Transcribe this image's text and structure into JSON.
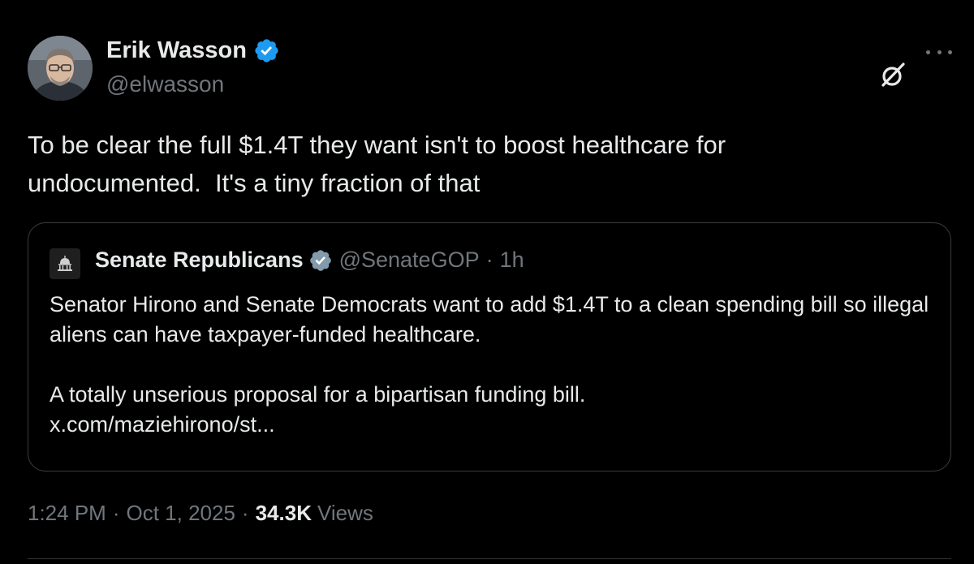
{
  "author": {
    "name": "Erik Wasson",
    "handle": "@elwasson",
    "verified": true
  },
  "tweet": {
    "text": "To be clear the full $1.4T they want isn't to boost healthcare for\nundocumented.  It's a tiny fraction of that"
  },
  "quoted": {
    "name": "Senate Republicans",
    "handle": "@SenateGOP",
    "separator": "·",
    "time": "1h",
    "paragraph1": "Senator Hirono and Senate Democrats want to add $1.4T to a clean spending bill so illegal aliens can have taxpayer-funded healthcare.",
    "paragraph2": "A totally unserious proposal for a bipartisan funding bill.",
    "link": "x.com/maziehirono/st..."
  },
  "meta": {
    "time": "1:24 PM",
    "separator": "·",
    "date": "Oct 1, 2025",
    "views_count": "34.3K",
    "views_label": "Views"
  },
  "icons": {
    "verified": "verified-badge-icon",
    "grok": "grok-icon",
    "more": "more-options-icon",
    "senate": "capitol-building-icon"
  },
  "colors": {
    "background": "#000000",
    "text": "#e7e9ea",
    "muted": "#71767b",
    "verified": "#1d9bf0",
    "border": "#3a3d41"
  }
}
